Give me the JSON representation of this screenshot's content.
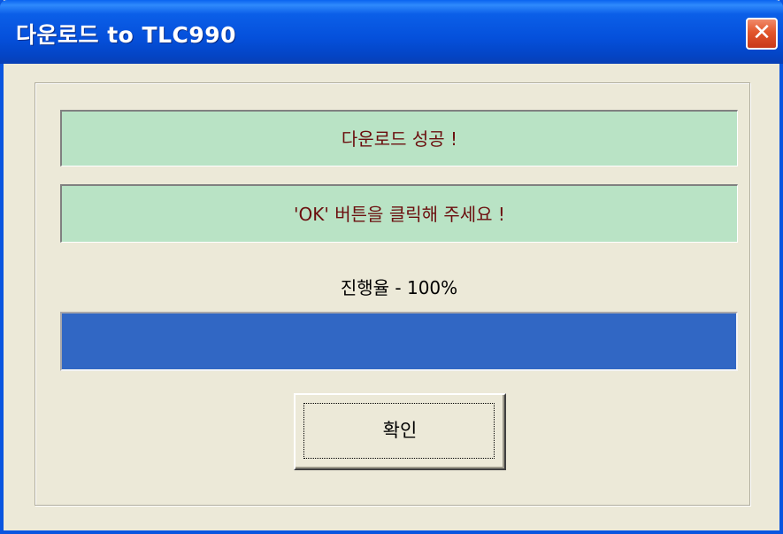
{
  "window": {
    "title": "다운로드 to TLC990",
    "close_icon": "close-icon",
    "close_glyph": "✕"
  },
  "messages": {
    "status": "다운로드 성공 !",
    "instruction": "'OK' 버튼을 클릭해 주세요 !"
  },
  "progress": {
    "label": "진행율 - 100%",
    "percent": 100
  },
  "buttons": {
    "ok_label": "확인"
  },
  "colors": {
    "title_bar": "#0550db",
    "message_background": "#b9e3c5",
    "message_text": "#6b0e0e",
    "progress_fill": "#3167c4",
    "dialog_background": "#ece9d8",
    "close_button": "#e2552a"
  }
}
